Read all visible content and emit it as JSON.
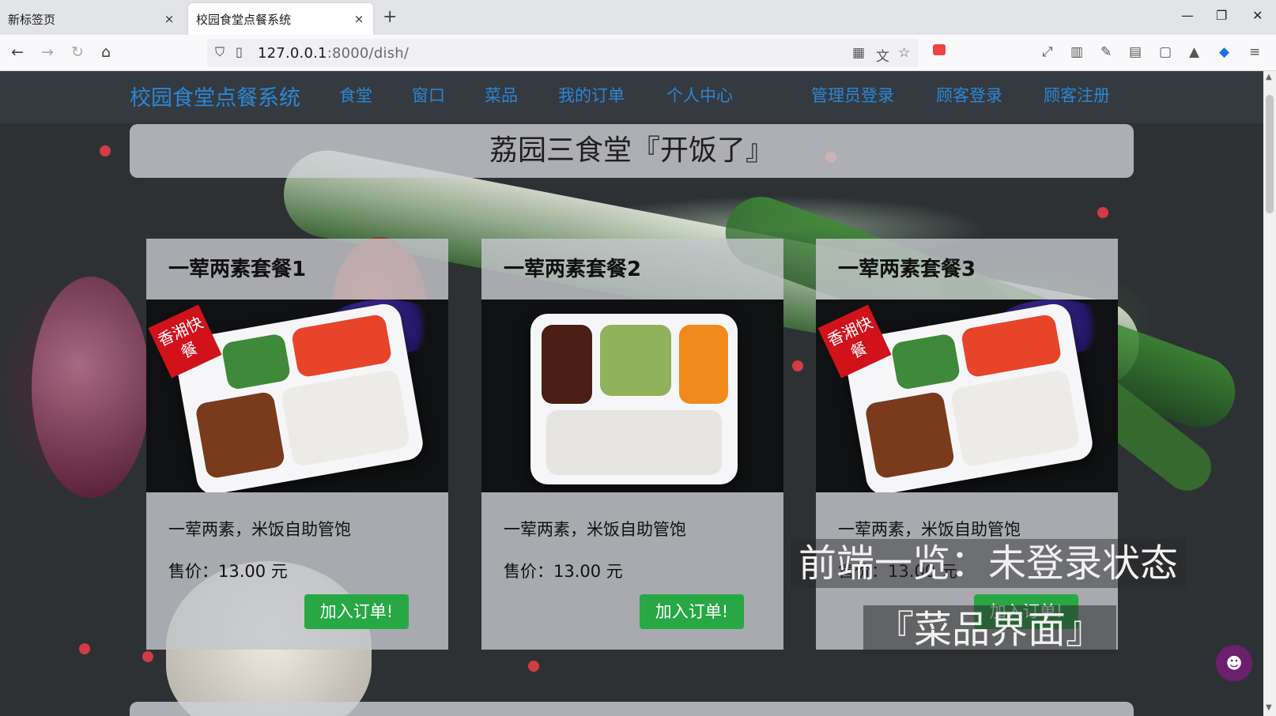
{
  "browser": {
    "tabs": [
      {
        "title": "新标签页",
        "active": false
      },
      {
        "title": "校园食堂点餐系统",
        "active": true
      }
    ],
    "new_tab_label": "+",
    "close_glyph": "×",
    "url_host": "127.0.0.1",
    "url_rest": ":8000/dish/",
    "window_controls": {
      "minimize": "—",
      "restore": "❐",
      "close": "✕"
    },
    "nav_icons": {
      "back": "←",
      "forward": "→",
      "reload": "↻",
      "home": "⌂"
    }
  },
  "site_nav": {
    "brand": "校园食堂点餐系统",
    "links": [
      "食堂",
      "窗口",
      "菜品",
      "我的订单",
      "个人中心"
    ],
    "auth_links": [
      "管理员登录",
      "顾客登录",
      "顾客注册"
    ],
    "brand_color": "#2c86d6"
  },
  "banner": {
    "title": "荔园三食堂『开饭了』"
  },
  "dishes": [
    {
      "name": "一荤两素套餐1",
      "description": "一荤两素，米饭自助管饱",
      "price": "售价：13.00 元",
      "button": "加入订单!",
      "badge": "香湘快餐"
    },
    {
      "name": "一荤两素套餐2",
      "description": "一荤两素，米饭自助管饱",
      "price": "售价：13.00 元",
      "button": "加入订单!"
    },
    {
      "name": "一荤两素套餐3",
      "description": "一荤两素，米饭自助管饱",
      "price": "售价：13.00 元",
      "button": "加入订单!",
      "badge": "香湘快餐"
    }
  ],
  "overlay": {
    "line1": "前端一览：未登录状态",
    "line2": "『菜品界面』"
  },
  "colors": {
    "button_green": "#28a745",
    "navbar_bg": "#343a40"
  }
}
